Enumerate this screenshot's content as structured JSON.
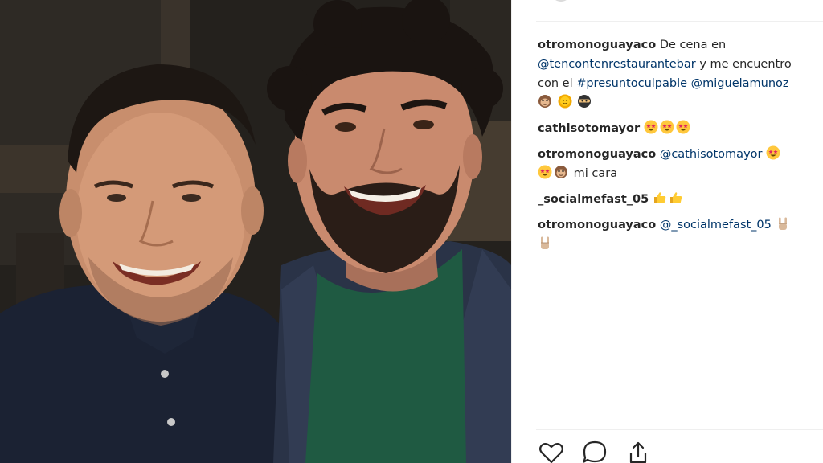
{
  "post": {
    "caption": {
      "username": "otromonoguayaco",
      "text_1": "De cena en",
      "mention_restaurant": "@tencontenrestaurantebar",
      "text_2": "y me encuentro",
      "text_3": "con el",
      "hashtag": "#presuntoculpable",
      "mention_actor": "@miguelamunoz",
      "emojis": [
        "monkey-face",
        "sun-face",
        "ninja-face"
      ]
    },
    "comments": [
      {
        "username": "cathisotomayor",
        "text": "",
        "emojis": [
          "star-struck",
          "star-struck",
          "star-struck"
        ]
      },
      {
        "username": "otromonoguayaco",
        "mention": "@cathisotomayor",
        "text": "mi cara",
        "emojis": [
          "star-struck",
          "star-struck",
          "monkey-face"
        ]
      },
      {
        "username": "_socialmefast_05",
        "text": "",
        "emojis": [
          "thumbs-up",
          "thumbs-up"
        ]
      },
      {
        "username": "otromonoguayaco",
        "mention": "@_socialmefast_05",
        "text": "",
        "emojis": [
          "rock-on-hand",
          "rock-on-hand"
        ]
      }
    ]
  },
  "actions": {
    "icons": [
      "heart-icon",
      "comment-icon",
      "share-icon"
    ]
  },
  "colors": {
    "username": "#262626",
    "link": "#003569",
    "divider": "#efefef",
    "photo_background": "#1f1c19"
  }
}
